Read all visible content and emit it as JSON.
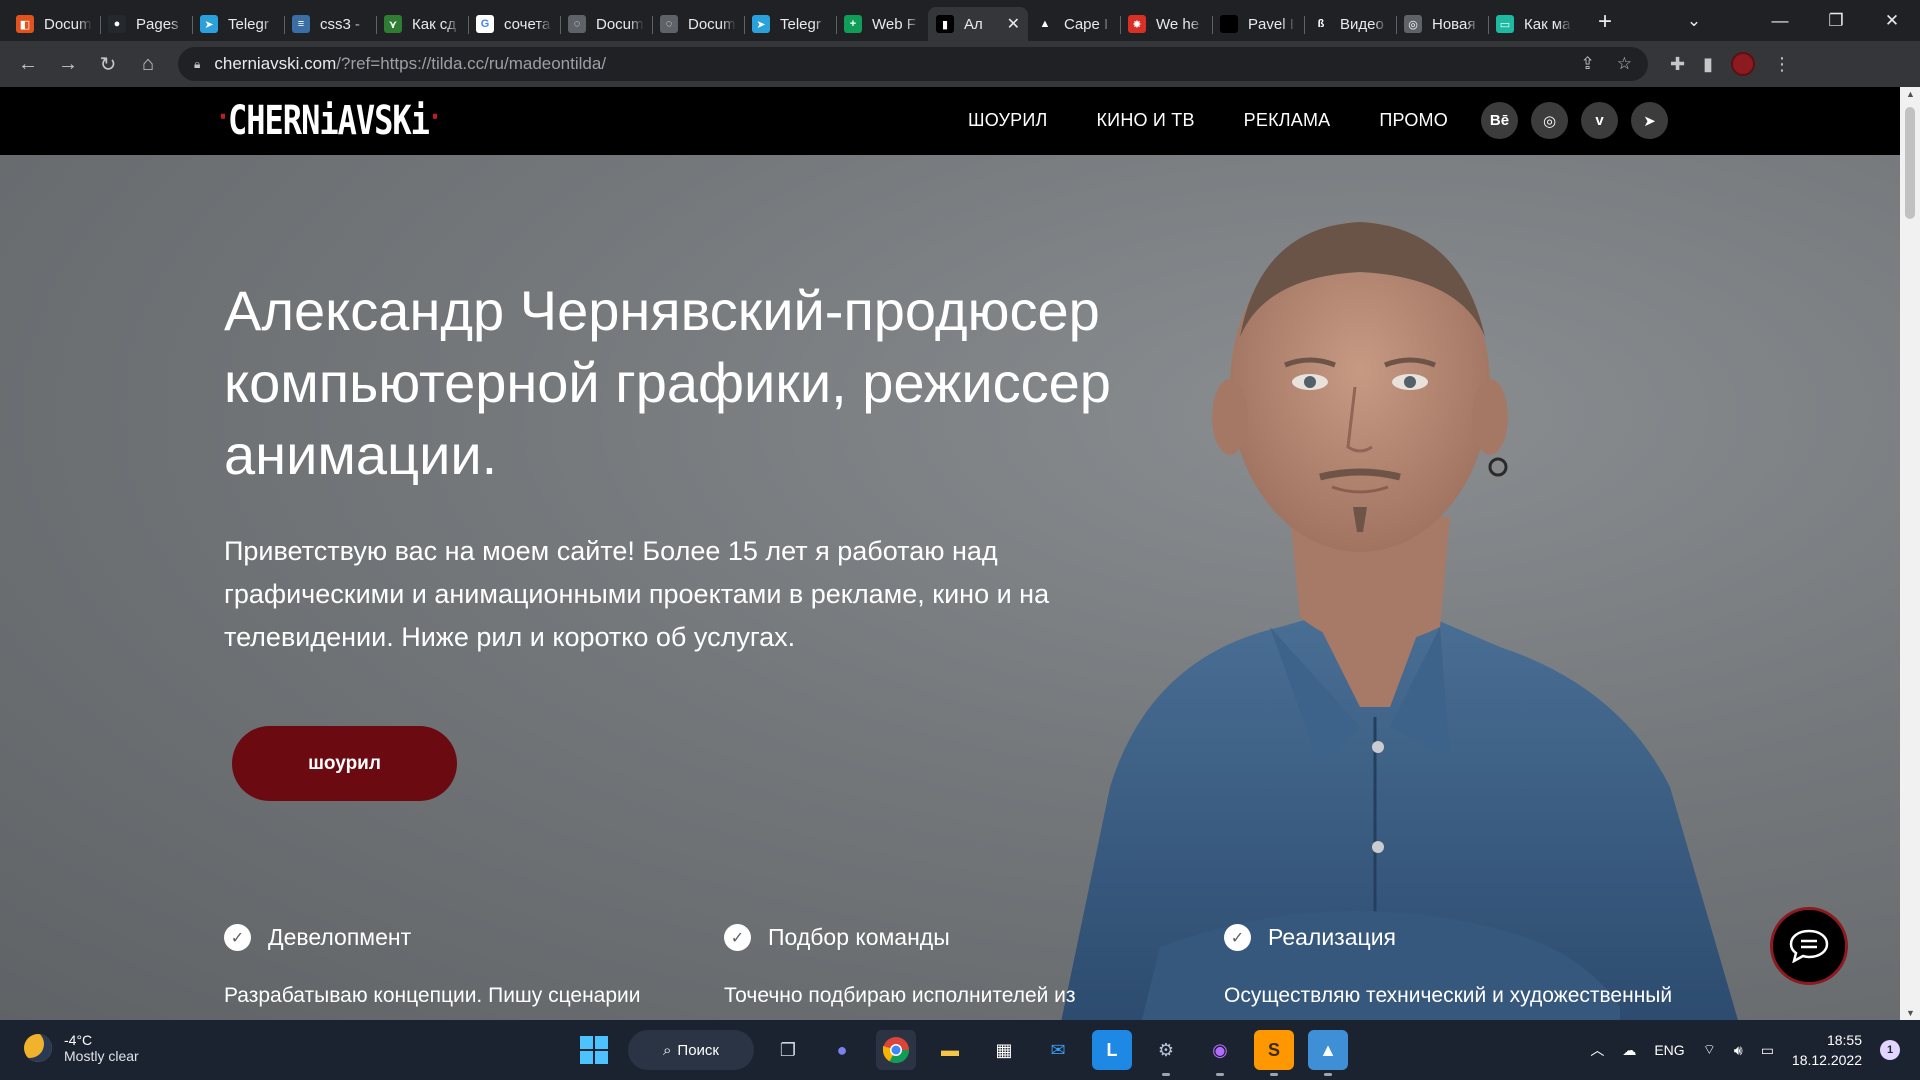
{
  "browser": {
    "tabs": [
      {
        "label": "Docum",
        "favicon_color": "#e2521d",
        "glyph": "◧"
      },
      {
        "label": "Pages",
        "favicon_color": "#24292e",
        "glyph": "●"
      },
      {
        "label": "Telegr",
        "favicon_color": "#2aa1da",
        "glyph": "➤"
      },
      {
        "label": "css3 -",
        "favicon_color": "#3a6ea5",
        "glyph": "≡"
      },
      {
        "label": "Как сд",
        "favicon_color": "#2e7d32",
        "glyph": "⋎"
      },
      {
        "label": "сочета",
        "favicon_color": "#ffffff",
        "glyph": "G"
      },
      {
        "label": "Docum",
        "favicon_color": "#5f6368",
        "glyph": "◌"
      },
      {
        "label": "Docum",
        "favicon_color": "#5f6368",
        "glyph": "◌"
      },
      {
        "label": "Telegr",
        "favicon_color": "#2aa1da",
        "glyph": "➤"
      },
      {
        "label": "Web F",
        "favicon_color": "#0f9d58",
        "glyph": "+"
      },
      {
        "label": "Ал",
        "favicon_color": "#000000",
        "glyph": "▮",
        "active": true
      },
      {
        "label": "Cape I",
        "favicon_color": "#202124",
        "glyph": "▲"
      },
      {
        "label": "We he",
        "favicon_color": "#d93025",
        "glyph": "✸"
      },
      {
        "label": "Pavel I",
        "favicon_color": "#000000",
        "glyph": " "
      },
      {
        "label": "Видео",
        "favicon_color": "#202124",
        "glyph": "ß"
      },
      {
        "label": "Новая",
        "favicon_color": "#5f6368",
        "glyph": "◎"
      },
      {
        "label": "Как ма",
        "favicon_color": "#1db9a2",
        "glyph": "▭"
      }
    ],
    "new_tab_glyph": "+",
    "url_host": "cherniavski.com",
    "url_rest": "/?ref=https://tilda.cc/ru/madeontilda/"
  },
  "site": {
    "logo": "CHERNiAVSKi",
    "nav": [
      "ШОУРИЛ",
      "КИНО И ТВ",
      "РЕКЛАМА",
      "ПРОМО"
    ],
    "social": [
      {
        "name": "behance-icon",
        "glyph": "Bē"
      },
      {
        "name": "instagram-icon",
        "glyph": "◎"
      },
      {
        "name": "vimeo-icon",
        "glyph": "v"
      },
      {
        "name": "telegram-icon",
        "glyph": "➤"
      }
    ],
    "hero_title": "Александр Чернявский-продюсер компьютерной графики, режиссер анимации.",
    "hero_text": "Приветствую вас на моем сайте! Более 15 лет я работаю над графическими и анимационными проектами в рекламе, кино и на телевидении. Ниже рил и коротко об услугах.",
    "cta_label": "шоурил",
    "features": [
      {
        "title": "Девелопмент",
        "desc": "Разрабатываю концепции. Пишу сценарии"
      },
      {
        "title": "Подбор команды",
        "desc": "Точечно подбираю исполнителей из"
      },
      {
        "title": "Реализация",
        "desc": "Осуществляю технический и художественный"
      }
    ],
    "accent_color": "#6b0a10"
  },
  "taskbar": {
    "weather_temp": "-4°C",
    "weather_desc": "Mostly clear",
    "search_label": "Поиск",
    "lang": "ENG",
    "time": "18:55",
    "date": "18.12.2022",
    "notification_count": "1"
  }
}
